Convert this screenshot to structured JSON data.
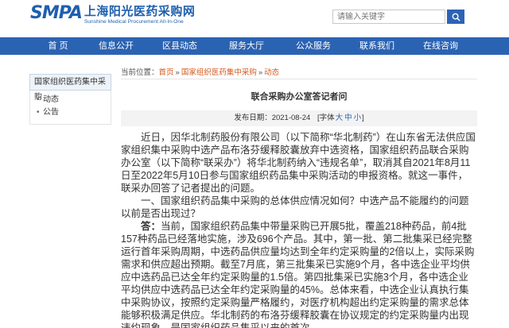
{
  "header": {
    "logo_smpa": "SMPA",
    "logo_cn": "上海阳光医药采购网",
    "logo_en": "Sunshine Medical Procurement All-In-One",
    "search_placeholder": "请输入关键字"
  },
  "nav": {
    "items": [
      {
        "label": "首 页"
      },
      {
        "label": "信息公开"
      },
      {
        "label": "区县动态"
      },
      {
        "label": "服务大厅"
      },
      {
        "label": "公众服务"
      },
      {
        "label": "联系我们"
      },
      {
        "label": "在线咨询"
      }
    ]
  },
  "sidebar": {
    "title": "国家组织医药集中采购",
    "items": [
      {
        "label": "动态"
      },
      {
        "label": "公告"
      }
    ]
  },
  "breadcrumb": {
    "prefix": "当前位置：",
    "crumbs": [
      "首页",
      "国家组织医药集中采购",
      "动态"
    ],
    "sep": "»"
  },
  "article": {
    "title": "联合采购办公室答记者问",
    "date_label": "发布日期：2021-08-24",
    "font_label": "[字体",
    "font_large": "大",
    "font_medium": "中",
    "font_small": "小",
    "font_close": "]",
    "para1": "近日，因华北制药股份有限公司（以下简称“华北制药”）在山东省无法供应国家组织集中采购中选产品布洛芬缓释胶囊放弃中选资格，国家组织药品联合采购办公室（以下简称“联采办”）将华北制药纳入“违规名单”，取消其自2021年8月11日至2022年5月10日参与国家组织药品集中采购活动的申报资格。就这一事件，联采办回答了记者提出的问题。",
    "para2": "一、国家组织药品集中采购的总体供应情况如何？中选产品不能履约的问题以前是否出现过？",
    "answer_label": "答：",
    "para3": "当前，国家组织药品集中带量采购已开展5批，覆盖218种药品，前4批157种药品已经落地实施，涉及696个产品。其中，第一批、第二批集采已经完整运行首年采购周期，中选药品供应量均达到全年约定采购量的2倍以上，实际采购需求和供应超出预期。截至7月底，第三批集采已实施9个月，各中选企业平均供应中选药品已达全年约定采购量的1.5倍。第四批集采已实施3个月，各中选企业平均供应中选药品已达全年约定采购量的45%。总体来看，中选企业认真执行集中采购协议，按照约定采购量严格履约，对医疗机构超出约定采购量的需求总体能够积极满足供应。华北制药的布洛芬缓释胶囊在协议规定的约定采购量内出现违约现象，是国家组织药品集采以来的首次。"
  }
}
